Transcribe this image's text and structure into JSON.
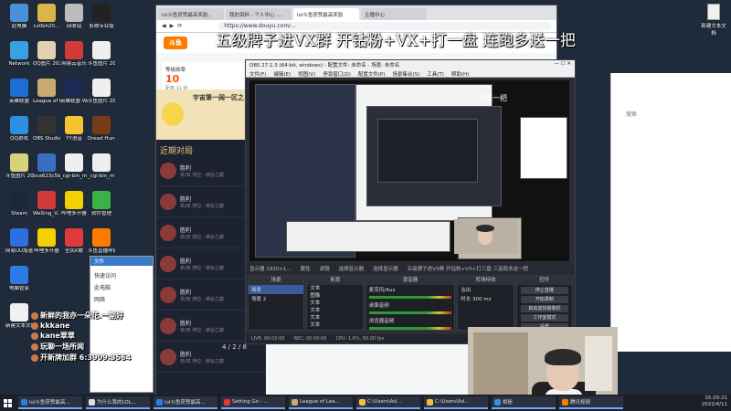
{
  "overlay": {
    "title": "五级牌子进VX群  开钻粉+VX+打一盘  连跑多送一把"
  },
  "desktop_icons": [
    {
      "label": "此电脑",
      "color": "#4a90d9"
    },
    {
      "label": "cz0bh20...",
      "color": "#d9b64a"
    },
    {
      "label": "回收站",
      "color": "#bbbbbb"
    },
    {
      "label": "剪映专业版",
      "color": "#222222"
    },
    {
      "label": "Network",
      "color": "#3aa0e0"
    },
    {
      "label": "QQ图片 2022031...",
      "color": "#e0d2b0"
    },
    {
      "label": "网易云音乐",
      "color": "#d33a3a"
    },
    {
      "label": "斗鱼图片 2022041...",
      "color": "#efefef"
    },
    {
      "label": "英雄联盟",
      "color": "#1d6fd3"
    },
    {
      "label": "League of Legends",
      "color": "#c8aa6e"
    },
    {
      "label": "英雄联盟 WeGame版",
      "color": "#1a2a55"
    },
    {
      "label": "斗鱼图片 2022041...",
      "color": "#efefef"
    },
    {
      "label": "QQ游戏",
      "color": "#2c8fe0"
    },
    {
      "label": "OBS Studio",
      "color": "#333333"
    },
    {
      "label": "YY语音",
      "color": "#f4c430"
    },
    {
      "label": "Dread Hunger",
      "color": "#7a3a1a"
    },
    {
      "label": "斗鱼图片 2022031...",
      "color": "#d9d07a"
    },
    {
      "label": "bca623c5b...",
      "color": "#3a6fc0"
    },
    {
      "label": "_cgi-bin_m...",
      "color": "#efefef"
    },
    {
      "label": "_cgi-bin_m...",
      "color": "#efefef"
    },
    {
      "label": "Steam",
      "color": "#1b2838"
    },
    {
      "label": "WeSing_V...",
      "color": "#d33a3a"
    },
    {
      "label": "哔哩多开器",
      "color": "#f5d000"
    },
    {
      "label": "软件管理",
      "color": "#3ab24a"
    },
    {
      "label": "网易UU加速器",
      "color": "#2d6ee0"
    },
    {
      "label": "哔哩多开器",
      "color": "#f5d000"
    },
    {
      "label": "全民K歌",
      "color": "#e03a3a"
    },
    {
      "label": "斗鱼直播伴侣",
      "color": "#ff7b00"
    },
    {
      "label": "电脑管家",
      "color": "#2c7be5"
    },
    {
      "label": "新建文本文档",
      "color": "#f0f0f0"
    }
  ],
  "browser": {
    "tabs": [
      "lol斗鱼获赞最高奖励...",
      "我的资料 - 个人中心 -...",
      "lol斗鱼获赞最高奖励",
      "主播中心"
    ],
    "active_tab": 2,
    "url": "https://www.douyu.com/..."
  },
  "douyu": {
    "logo": "斗鱼",
    "card_label": "等级勋章",
    "card_num": "10",
    "card_sub": "距离 11 级",
    "promo_title": "宇宙第一阔一区之...",
    "game_title": "英雄联盟",
    "section_label": "近期对局",
    "players": [
      {
        "name": "胜利",
        "sub": "单/双 排位 · 峡谷之巅"
      },
      {
        "name": "胜利",
        "sub": "单/双 排位 · 峡谷之巅"
      },
      {
        "name": "胜利",
        "sub": "单/双 排位 · 峡谷之巅"
      },
      {
        "name": "胜利",
        "sub": "单/双 排位 · 峡谷之巅"
      },
      {
        "name": "胜利",
        "sub": "单/双 排位 · 峡谷之巅"
      },
      {
        "name": "胜利",
        "sub": "单/双 排位 · 峡谷之巅"
      },
      {
        "name": "胜利",
        "sub": "单/双 排位 · 峡谷之巅"
      }
    ],
    "score": "4 / 2 / 8"
  },
  "obs": {
    "title": "OBS 27.1.3 (64-bit, windows) - 配置文件: 未命名 - 场景: 未命名",
    "menu": [
      "文件(F)",
      "编辑(E)",
      "视图(V)",
      "停靠窗口(D)",
      "配置文件(P)",
      "场景集合(S)",
      "工具(T)",
      "帮助(H)"
    ],
    "source_bar": [
      "显示器 1920×1...",
      "属性",
      "滤镜",
      "选择显示器",
      "选择显示器",
      "五级牌子进VX群 开钻粉+VX+打三盘 三连跑多送一把"
    ],
    "docks": {
      "scenes": {
        "head": "场景",
        "items": [
          "场景",
          "场景 2"
        ]
      },
      "sources": {
        "head": "来源",
        "items": [
          "文本",
          "图像",
          "文本",
          "文本",
          "文本",
          "文本"
        ]
      },
      "mixer": {
        "head": "混音器",
        "items": [
          "麦克风/Aux",
          "桌面音频",
          "浏览器音频"
        ]
      },
      "transitions": {
        "head": "转场特效",
        "items": [
          "淡出",
          "时长 300 ms"
        ]
      },
      "controls": {
        "head": "控件",
        "buttons": [
          "停止直播",
          "开始录制",
          "启动虚拟摄像机",
          "工作室模式",
          "设置",
          "退出"
        ]
      }
    },
    "status": [
      "LIVE: 00:00:00",
      "REC: 00:00:00",
      "CPU: 1.6%, 60.00 fps"
    ]
  },
  "right_panel": {
    "hint": "搜索"
  },
  "explorer": {
    "head": "文件",
    "items": [
      "快速访问",
      "此电脑",
      "网络"
    ]
  },
  "chat": [
    "新鲜的我亦一朵花.一副好",
    "kkkane",
    "kane翠翠",
    "玩聊一场所闻",
    "开新牌加群 6:3909:3564"
  ],
  "taskbar": {
    "items": [
      {
        "label": "lol斗鱼获赞最高...",
        "color": "#2c7be5"
      },
      {
        "label": "为什么我的LOL...",
        "color": "#e0e0e0"
      },
      {
        "label": "lol斗鱼获赞最高...",
        "color": "#2c7be5"
      },
      {
        "label": "Setting Go - ...",
        "color": "#e03a3a"
      },
      {
        "label": "League of Lea...",
        "color": "#c8aa6e"
      },
      {
        "label": "C:\\Users\\Ad...",
        "color": "#f0c040"
      },
      {
        "label": "C:\\Users\\Ad...",
        "color": "#f0c040"
      },
      {
        "label": "相册",
        "color": "#3a8fe0"
      },
      {
        "label": "腾讯视频",
        "color": "#ff7b00"
      }
    ],
    "time": "15:29:21",
    "date": "2022/4/11"
  },
  "top_right_icon": {
    "label": "新建文本文档",
    "color": "#f0f0f0"
  }
}
